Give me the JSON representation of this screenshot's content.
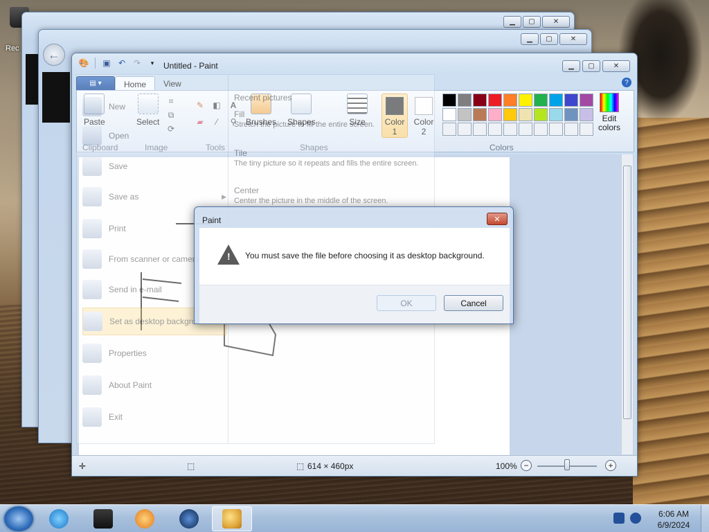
{
  "desktop": {
    "icon_label": "Rec"
  },
  "paint": {
    "title": "Untitled - Paint",
    "tabs": [
      "Home",
      "View"
    ],
    "groups": {
      "clipboard": "Clipboard",
      "image": "Image",
      "tools": "Tools",
      "shapes": "Shapes",
      "colors": "Colors"
    },
    "tools": {
      "paste": "Paste",
      "select": "Select",
      "brushes": "Brushes",
      "shapes": "Shapes",
      "size": "Size",
      "color1": "Color\n1",
      "color2": "Color\n2",
      "edit_colors": "Edit colors"
    },
    "palette": [
      "#000000",
      "#7f7f7f",
      "#880015",
      "#ed1c24",
      "#ff7f27",
      "#fff200",
      "#22b14c",
      "#00a2e8",
      "#3f48cc",
      "#a349a4",
      "#ffffff",
      "#c3c3c3",
      "#b97a57",
      "#ffaec9",
      "#ffc90e",
      "#efe4b0",
      "#b5e61d",
      "#99d9ea",
      "#7092be",
      "#c8bfe7"
    ],
    "status": {
      "size": "614 × 460px",
      "zoom": "100%"
    }
  },
  "file_menu": {
    "items": [
      "New",
      "Open",
      "Save",
      "Save as",
      "Print",
      "From scanner or camera",
      "Send in e-mail",
      "Set as desktop background",
      "Properties",
      "About Paint",
      "Exit"
    ],
    "recent_header": "Recent pictures",
    "fill_title": "Fill",
    "fill_desc": "Stretch the picture to fill the entire screen.",
    "tile_title": "Tile",
    "tile_desc": "The tiny picture so it repeats and fills the entire screen.",
    "center_title": "Center",
    "center_desc": "Center the picture in the middle of the screen."
  },
  "dialog": {
    "title": "Paint",
    "message": "You must save the file before choosing it as desktop background.",
    "ok": "OK",
    "cancel": "Cancel"
  },
  "taskbar": {
    "time": "6:06 AM",
    "date": "6/9/2024"
  }
}
